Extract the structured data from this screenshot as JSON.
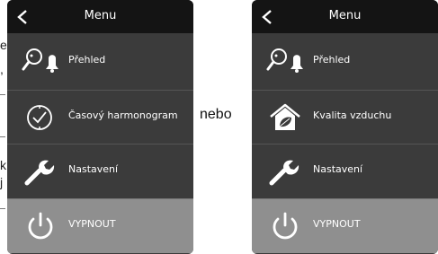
{
  "edge_text": [
    "e",
    ",",
    "k",
    "j"
  ],
  "connector": "nebo",
  "panels": [
    {
      "header": {
        "title": "Menu"
      },
      "items": [
        {
          "label": "Přehled",
          "icon": "overview-bell-icon"
        },
        {
          "label": "Časový harmonogram",
          "icon": "clock-schedule-icon"
        },
        {
          "label": "Nastavení",
          "icon": "wrench-icon"
        },
        {
          "label": "VYPNOUT",
          "icon": "power-icon"
        }
      ]
    },
    {
      "header": {
        "title": "Menu"
      },
      "items": [
        {
          "label": "Přehled",
          "icon": "overview-bell-icon"
        },
        {
          "label": "Kvalita vzduchu",
          "icon": "house-leaf-icon"
        },
        {
          "label": "Nastavení",
          "icon": "wrench-icon"
        },
        {
          "label": "VYPNOUT",
          "icon": "power-icon"
        }
      ]
    }
  ],
  "colors": {
    "header_bg": "#141414",
    "item_bg": "#3b3b3b",
    "off_bg": "#8f8f8f",
    "icon_white": "#ffffff"
  }
}
